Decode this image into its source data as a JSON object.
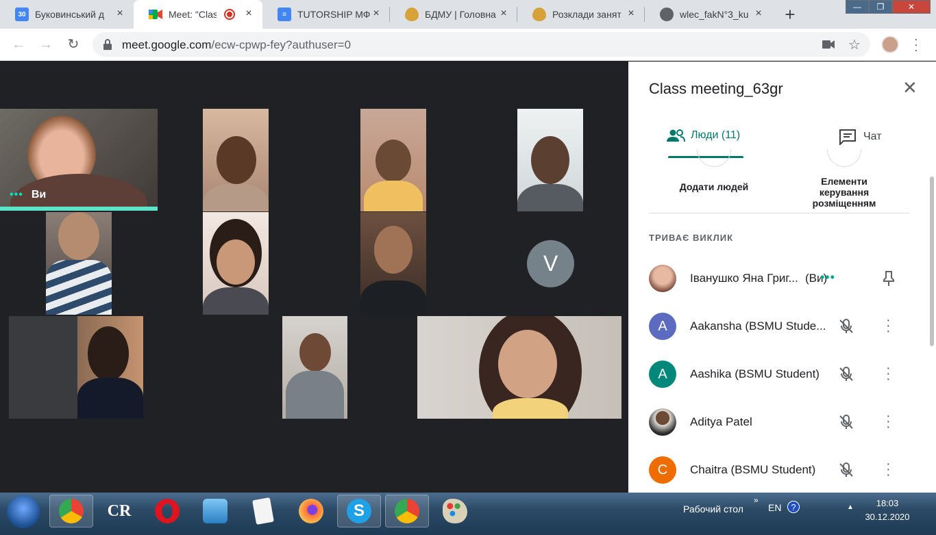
{
  "browser": {
    "tabs": [
      {
        "title": "Буковинський д",
        "favicon": "calendar-icon",
        "badge": "30"
      },
      {
        "title": "Meet: \"Class",
        "favicon": "meet-icon",
        "recording": true
      },
      {
        "title": "TUTORSHIP МФ",
        "favicon": "docs-icon"
      },
      {
        "title": "БДМУ | Головна",
        "favicon": "bsmu-icon"
      },
      {
        "title": "Розклади занят",
        "favicon": "bsmu-icon"
      },
      {
        "title": "wlec_fakN°3_ku",
        "favicon": "globe-icon"
      }
    ],
    "url_host": "meet.google.com",
    "url_path": "/ecw-cpwp-fey?authuser=0"
  },
  "meeting": {
    "self_label": "Ви",
    "placeholder_initial": "V"
  },
  "panel": {
    "title": "Class meeting_63gr",
    "tabs": {
      "people": "Люди (11)",
      "chat": "Чат"
    },
    "actions": {
      "add_people": "Додати людей",
      "layout_controls": "Елементи керування розміщенням"
    },
    "section_label": "ТРИВАЄ ВИКЛИК",
    "participants": [
      {
        "name": "Іванушко Яна Григ...",
        "suffix": "(Ви)",
        "initial": "",
        "color": "#c9a08a"
      },
      {
        "name": "Aakansha (BSMU Stude...",
        "initial": "A",
        "color": "#5c6bc0"
      },
      {
        "name": "Aashika (BSMU Student)",
        "initial": "A",
        "color": "#00897b"
      },
      {
        "name": "Aditya Patel",
        "initial": "",
        "color": "#8d7b6a"
      },
      {
        "name": "Chaitra (BSMU Student)",
        "initial": "C",
        "color": "#ef6c00"
      }
    ]
  },
  "taskbar": {
    "desktop_label": "Рабочий стол",
    "language": "EN",
    "time": "18:03",
    "date": "30.12.2020",
    "cr_label": "CR"
  }
}
